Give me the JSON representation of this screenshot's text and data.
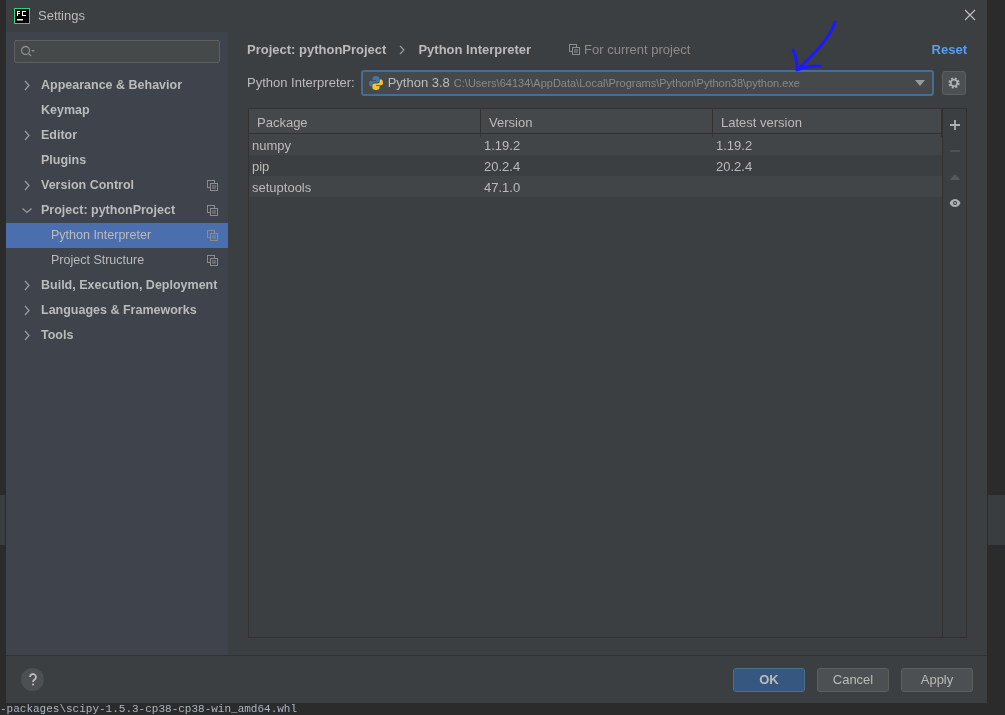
{
  "window": {
    "title": "Settings"
  },
  "sidebar": {
    "items": [
      {
        "label": "Appearance & Behavior",
        "kind": "group",
        "expanded": false,
        "project_level": false,
        "selected": false
      },
      {
        "label": "Keymap",
        "kind": "page",
        "project_level": false,
        "selected": false
      },
      {
        "label": "Editor",
        "kind": "group",
        "expanded": false,
        "project_level": false,
        "selected": false
      },
      {
        "label": "Plugins",
        "kind": "page",
        "project_level": false,
        "selected": false
      },
      {
        "label": "Version Control",
        "kind": "group",
        "expanded": false,
        "project_level": true,
        "selected": false
      },
      {
        "label": "Project: pythonProject",
        "kind": "group",
        "expanded": true,
        "project_level": true,
        "selected": false,
        "children": [
          {
            "label": "Python Interpreter",
            "project_level": true,
            "selected": true
          },
          {
            "label": "Project Structure",
            "project_level": true,
            "selected": false
          }
        ]
      },
      {
        "label": "Build, Execution, Deployment",
        "kind": "group",
        "expanded": false,
        "project_level": false,
        "selected": false
      },
      {
        "label": "Languages & Frameworks",
        "kind": "group",
        "expanded": false,
        "project_level": false,
        "selected": false
      },
      {
        "label": "Tools",
        "kind": "group",
        "expanded": false,
        "project_level": false,
        "selected": false
      }
    ]
  },
  "breadcrumb": [
    "Project: pythonProject",
    "Python Interpreter"
  ],
  "scope_note": "For current project",
  "reset": "Reset",
  "interpreter": {
    "label": "Python Interpreter:",
    "name": "Python 3.8",
    "path": "C:\\Users\\64134\\AppData\\Local\\Programs\\Python\\Python38\\python.exe"
  },
  "table": {
    "columns": [
      "Package",
      "Version",
      "Latest version"
    ],
    "rows": [
      [
        "numpy",
        "1.19.2",
        "1.19.2"
      ],
      [
        "pip",
        "20.2.4",
        "20.2.4"
      ],
      [
        "setuptools",
        "47.1.0",
        ""
      ]
    ]
  },
  "table_toolbar": [
    {
      "kind": "add",
      "disabled": false
    },
    {
      "kind": "remove",
      "disabled": true
    },
    {
      "kind": "upgrade",
      "disabled": true
    },
    {
      "kind": "show",
      "disabled": false
    }
  ],
  "buttons": [
    {
      "label": "OK",
      "default": true
    },
    {
      "label": "Cancel",
      "default": false
    },
    {
      "label": "Apply",
      "default": false
    }
  ],
  "terminal_line": "-packages\\scipy-1.5.3-cp38-cp38-win_amd64.whl"
}
